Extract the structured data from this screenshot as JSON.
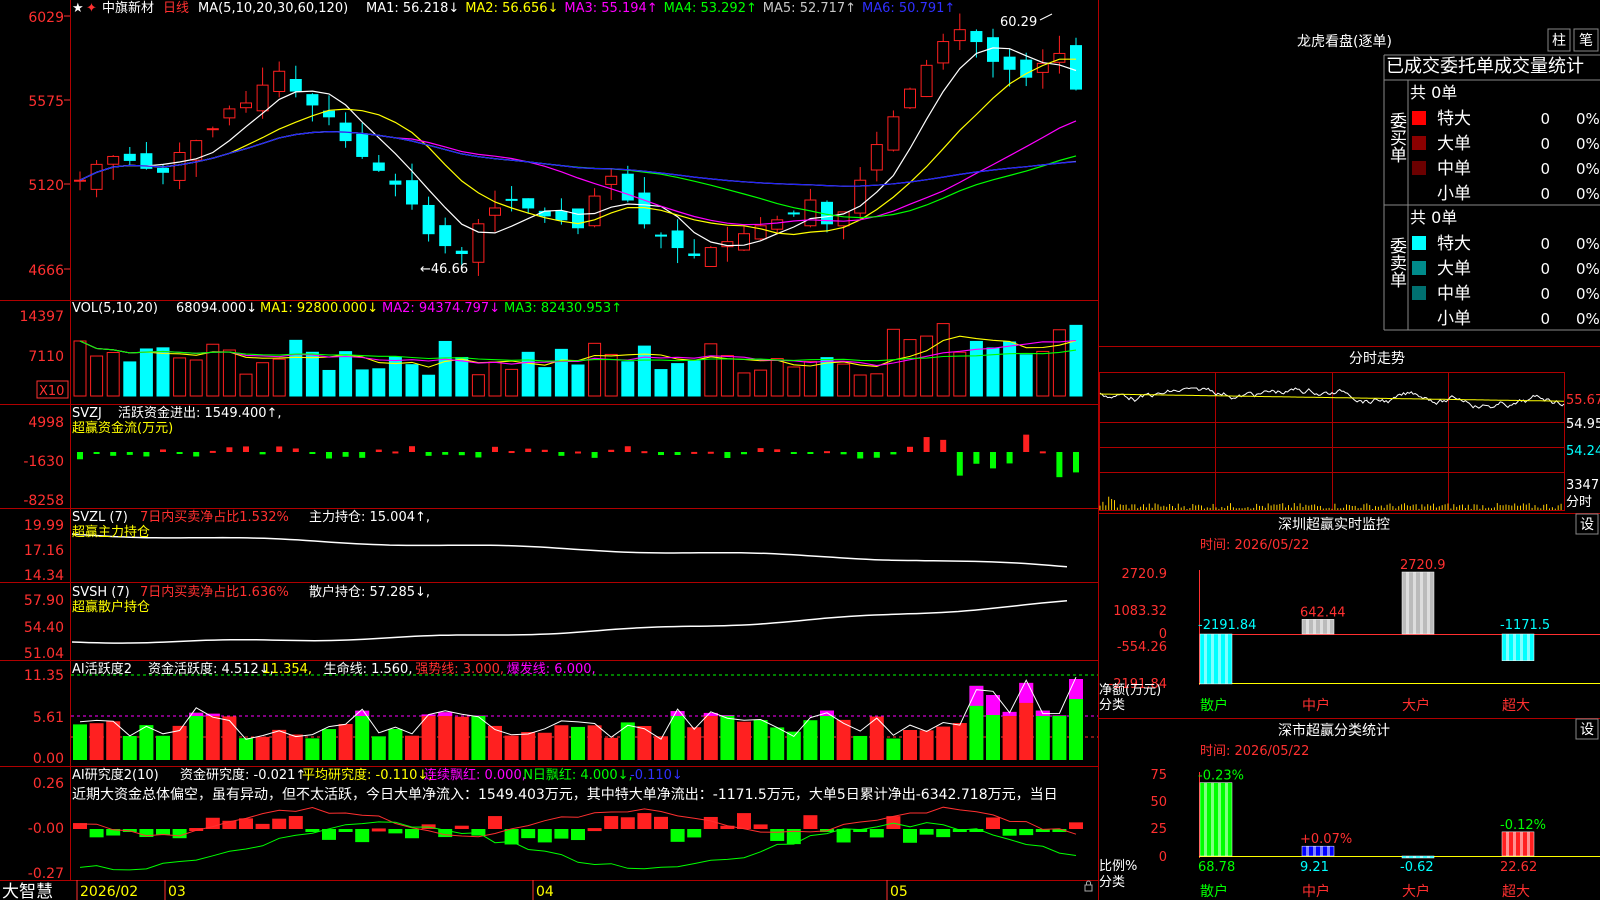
{
  "stock": {
    "name": "中旗新材",
    "period": "日线",
    "star": "★"
  },
  "colors": {
    "up": "#ff2020",
    "down": "#00ffff",
    "ma1": "#ffffff",
    "ma2": "#ffff00",
    "ma3": "#ff00ff",
    "ma4": "#00ff00",
    "ma5": "#c8c8c8",
    "ma6": "#0000ff",
    "border": "#b00000",
    "axis": "#ff3030",
    "grid": "#b00000",
    "yellow": "#ffff00",
    "green": "#00ff00",
    "magenta": "#ff00ff"
  },
  "main": {
    "axis_labels": [
      "6029",
      "5575",
      "5120",
      "4666"
    ],
    "ind_name": "MA(5,10,20,30,60,120)",
    "ma_items": [
      {
        "label": "MA1: 56.218↓",
        "color": "#ffffff"
      },
      {
        "label": "MA2: 56.656↓",
        "color": "#ffff00"
      },
      {
        "label": "MA3: 55.194↑",
        "color": "#ff00ff"
      },
      {
        "label": "MA4: 53.292↑",
        "color": "#00ff00"
      },
      {
        "label": "MA5: 52.717↑",
        "color": "#c8c8c8"
      },
      {
        "label": "MA6: 50.791↑",
        "color": "#3030ff"
      }
    ],
    "high_label": "60.29",
    "low_label": "←46.66"
  },
  "vol": {
    "axis_labels": [
      "14397",
      "7110"
    ],
    "unit": "X10",
    "ind_name": "VOL(5,10,20)",
    "items": [
      {
        "label": "68094.000↓",
        "color": "#ffffff"
      },
      {
        "label": "MA1: 92800.000↓",
        "color": "#ffff00"
      },
      {
        "label": "MA2: 94374.797↓",
        "color": "#ff00ff"
      },
      {
        "label": "MA3: 82430.953↑",
        "color": "#00ff00"
      }
    ]
  },
  "svzj": {
    "axis_labels": [
      "4998",
      "-1630",
      "-8258"
    ],
    "ind_name": "SVZJ",
    "item": "活跃资金进出: 1549.400↑,",
    "title": "超赢资金流(万元)"
  },
  "svzl": {
    "axis_labels": [
      "19.99",
      "17.16",
      "14.34"
    ],
    "ind_name": "SVZL (7)",
    "item1": "7日内买卖净占比1.532%",
    "item2": "主力持仓: 15.004↑,",
    "title": "超赢主力持仓"
  },
  "svsh": {
    "axis_labels": [
      "57.90",
      "54.40",
      "51.04"
    ],
    "ind_name": "SVSH (7)",
    "item1": "7日内买卖净占比1.636%",
    "item2": "散户持仓: 57.285↓,",
    "title": "超赢散户持仓"
  },
  "ai1": {
    "axis_labels": [
      "11.35",
      "5.61",
      "0.00"
    ],
    "ind_name": "AI活跃度2",
    "items": [
      {
        "label": "资金活跃度: 4.512↓,",
        "color": "#ffffff"
      },
      {
        "label": "11.354,",
        "color": "#ffff00"
      },
      {
        "label": "生命线: 1.560,",
        "color": "#ffffff"
      },
      {
        "label": "强势线: 3.000,",
        "color": "#ff3030"
      },
      {
        "label": "爆发线: 6.000,",
        "color": "#ff00ff"
      }
    ]
  },
  "ai2": {
    "axis_labels": [
      "0.26",
      "-0.00",
      "-0.27"
    ],
    "ind_name": "AI研究度2(10)",
    "items": [
      {
        "label": "资金研究度: -0.021↑,",
        "color": "#ffffff"
      },
      {
        "label": "平均研究度: -0.110↓,",
        "color": "#ffff00"
      },
      {
        "label": "连续飘红: 0.000,",
        "color": "#ff00ff"
      },
      {
        "label": "N日飘红: 4.000↓,",
        "color": "#00ff00"
      },
      {
        "label": "-0.110↓",
        "color": "#3030ff"
      }
    ],
    "comment": "近期大资金总体偏空，虽有异动，但不太活跃，今日大单净流入：1549.403万元，其中特大单净流出：-1171.5万元，大单5日累计净出-6342.718万元，当日"
  },
  "bottom": {
    "brand": "大智慧",
    "dates": [
      "2026/02",
      "03",
      "04",
      "05"
    ]
  },
  "lhb": {
    "title": "龙虎看盘(逐单)",
    "btn1": "柱",
    "btn2": "笔",
    "subtitle": "已成交委托单成交量统计",
    "buy_label": "委买单",
    "sell_label": "委卖单",
    "buy_total": "共 0单",
    "sell_total": "共 0单",
    "buy_rows": [
      {
        "name": "特大",
        "val": "0",
        "pct": "0%",
        "color": "#ff0000"
      },
      {
        "name": "大单",
        "val": "0",
        "pct": "0%",
        "color": "#8b0000"
      },
      {
        "name": "中单",
        "val": "0",
        "pct": "0%",
        "color": "#6b0000"
      },
      {
        "name": "小单",
        "val": "0",
        "pct": "0%",
        "color": ""
      }
    ],
    "sell_rows": [
      {
        "name": "特大",
        "val": "0",
        "pct": "0%",
        "color": "#00ffff"
      },
      {
        "name": "大单",
        "val": "0",
        "pct": "0%",
        "color": "#008b8b"
      },
      {
        "name": "中单",
        "val": "0",
        "pct": "0%",
        "color": "#007070"
      },
      {
        "name": "小单",
        "val": "0",
        "pct": "0%",
        "color": ""
      }
    ]
  },
  "fenshi": {
    "title": "分时走势",
    "labels": [
      "55.67",
      "54.95",
      "54.24"
    ],
    "vol_label": "3347",
    "vol_unit": "分时"
  },
  "sz_monitor": {
    "title": "深圳超赢实时监控",
    "btn": "设",
    "time": "时间: 2026/05/22",
    "axis_labels": [
      "2720.9",
      "1083.32",
      "0",
      "-554.26",
      "-2191.84"
    ],
    "y_label": "净额(万元)",
    "x_label": "分类",
    "categories": [
      "散户",
      "中户",
      "大户",
      "超大"
    ],
    "values": [
      -2191.84,
      642.44,
      2720.9,
      -1171.5
    ],
    "value_labels": [
      "-2191.84",
      "642.44",
      "2720.9",
      "-1171.5"
    ]
  },
  "sz_class": {
    "title": "深市超赢分类统计",
    "btn": "设",
    "time": "时间: 2026/05/22",
    "axis_labels": [
      "75",
      "50",
      "25",
      "0"
    ],
    "y_label": "比例%",
    "x_label": "分类",
    "categories": [
      "散户",
      "中户",
      "大户",
      "超大"
    ],
    "values": [
      68.78,
      9.21,
      -0.62,
      22.62
    ],
    "value_labels": [
      "68.78",
      "9.21",
      "-0.62",
      "22.62"
    ],
    "deltas": [
      "-0.23%",
      "+0.07%",
      "",
      "-0.12%"
    ]
  },
  "chart_data": [
    {
      "type": "bar",
      "title": "深圳超赢实时监控",
      "ylabel": "净额(万元)",
      "categories": [
        "散户",
        "中户",
        "大户",
        "超大"
      ],
      "values": [
        -2191.84,
        642.44,
        2720.9,
        -1171.5
      ],
      "ylim": [
        -2191.84,
        2720.9
      ]
    },
    {
      "type": "bar",
      "title": "深市超赢分类统计",
      "ylabel": "比例%",
      "categories": [
        "散户",
        "中户",
        "大户",
        "超大"
      ],
      "values": [
        68.78,
        9.21,
        -0.62,
        22.62
      ],
      "ylim": [
        0,
        75
      ]
    }
  ]
}
